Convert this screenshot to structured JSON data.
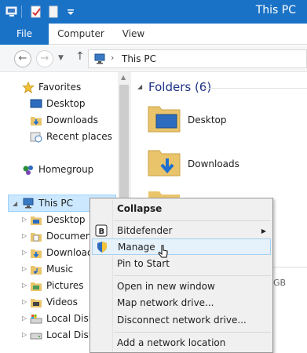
{
  "window": {
    "title": "This PC"
  },
  "quick_access": [
    "properties-icon",
    "new-folder-icon",
    "customize-qat-icon"
  ],
  "ribbon": {
    "tabs": [
      "File",
      "Computer",
      "View"
    ]
  },
  "address": {
    "separator": "›",
    "crumb": "This PC"
  },
  "nav": {
    "favorites": "Favorites",
    "favorites_items": [
      "Desktop",
      "Downloads",
      "Recent places"
    ],
    "homegroup": "Homegroup",
    "this_pc": "This PC",
    "this_pc_items": [
      "Desktop",
      "Documents",
      "Downloads",
      "Music",
      "Pictures",
      "Videos",
      "Local Disk",
      "Local Disk"
    ]
  },
  "content": {
    "group_header": "Folders (6)",
    "folders": [
      "Desktop",
      "Downloads"
    ],
    "partial_text": "GB"
  },
  "context_menu": {
    "items": [
      "Collapse",
      "Bitdefender",
      "Manage",
      "Pin to Start",
      "Open in new window",
      "Map network drive...",
      "Disconnect network drive...",
      "Add a network location"
    ],
    "highlighted": "Manage"
  },
  "colors": {
    "accent": "#1a72c6",
    "selection": "#cce8ff",
    "menu_hover": "#e5f1fb"
  }
}
